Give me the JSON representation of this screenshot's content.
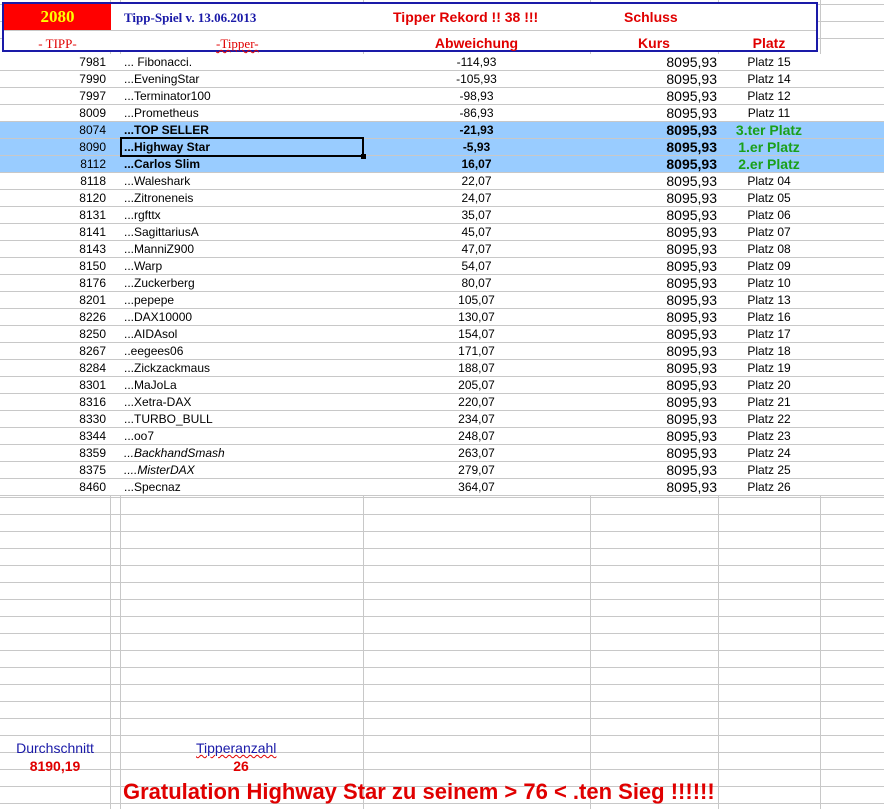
{
  "header": {
    "count": "2080",
    "title": "Tipp-Spiel v. 13.06.2013",
    "record": "Tipper Rekord !!  38  !!!",
    "schluss": "Schluss",
    "col_tipp": "- TIPP-",
    "col_tipper": "-Tipper-",
    "col_abw": "Abweichung",
    "col_kurs": "Kurs",
    "col_platz": "Platz"
  },
  "colors": {
    "accent_red": "#ff0000",
    "highlight": "#99ccff",
    "green": "#1aa01a",
    "blue": "#1a1aa8"
  },
  "rows": [
    {
      "tipp": "7981",
      "name": "... Fibonacci.",
      "abw": "-114,93",
      "kurs": "8095,93",
      "platz": "Platz 15"
    },
    {
      "tipp": "7990",
      "name": "...EveningStar",
      "abw": "-105,93",
      "kurs": "8095,93",
      "platz": "Platz 14"
    },
    {
      "tipp": "7997",
      "name": "...Terminator100",
      "abw": "-98,93",
      "kurs": "8095,93",
      "platz": "Platz 12"
    },
    {
      "tipp": "8009",
      "name": "...Prometheus",
      "abw": "-86,93",
      "kurs": "8095,93",
      "platz": "Platz 11"
    },
    {
      "tipp": "8074",
      "name": "...TOP  SELLER",
      "abw": "-21,93",
      "kurs": "8095,93",
      "platz": "3.ter Platz",
      "hl": true
    },
    {
      "tipp": "8090",
      "name": "...Highway  Star",
      "abw": "-5,93",
      "kurs": "8095,93",
      "platz": "1.er Platz",
      "hl": true
    },
    {
      "tipp": "8112",
      "name": "...Carlos Slim",
      "abw": "16,07",
      "kurs": "8095,93",
      "platz": "2.er Platz",
      "hl": true
    },
    {
      "tipp": "8118",
      "name": "...Waleshark",
      "abw": "22,07",
      "kurs": "8095,93",
      "platz": "Platz 04"
    },
    {
      "tipp": "8120",
      "name": "...Zitroneneis",
      "abw": "24,07",
      "kurs": "8095,93",
      "platz": "Platz 05"
    },
    {
      "tipp": "8131",
      "name": "...rgfttx",
      "abw": "35,07",
      "kurs": "8095,93",
      "platz": "Platz 06"
    },
    {
      "tipp": "8141",
      "name": "...SagittariusA",
      "abw": "45,07",
      "kurs": "8095,93",
      "platz": "Platz 07"
    },
    {
      "tipp": "8143",
      "name": "...ManniZ900",
      "abw": "47,07",
      "kurs": "8095,93",
      "platz": "Platz 08"
    },
    {
      "tipp": "8150",
      "name": "...Warp",
      "abw": "54,07",
      "kurs": "8095,93",
      "platz": "Platz 09"
    },
    {
      "tipp": "8176",
      "name": "...Zuckerberg",
      "abw": "80,07",
      "kurs": "8095,93",
      "platz": "Platz 10"
    },
    {
      "tipp": "8201",
      "name": "...pepepe",
      "abw": "105,07",
      "kurs": "8095,93",
      "platz": "Platz 13"
    },
    {
      "tipp": "8226",
      "name": "...DAX10000",
      "abw": "130,07",
      "kurs": "8095,93",
      "platz": "Platz 16"
    },
    {
      "tipp": "8250",
      "name": "...AIDAsol",
      "abw": "154,07",
      "kurs": "8095,93",
      "platz": "Platz 17"
    },
    {
      "tipp": "8267",
      "name": "..eegees06",
      "abw": "171,07",
      "kurs": "8095,93",
      "platz": "Platz 18"
    },
    {
      "tipp": "8284",
      "name": "...Zickzackmaus",
      "abw": "188,07",
      "kurs": "8095,93",
      "platz": "Platz 19"
    },
    {
      "tipp": "8301",
      "name": "...MaJoLa",
      "abw": "205,07",
      "kurs": "8095,93",
      "platz": "Platz 20"
    },
    {
      "tipp": "8316",
      "name": "...Xetra-DAX",
      "abw": "220,07",
      "kurs": "8095,93",
      "platz": "Platz 21"
    },
    {
      "tipp": "8330",
      "name": "...TURBO_BULL",
      "abw": "234,07",
      "kurs": "8095,93",
      "platz": "Platz 22"
    },
    {
      "tipp": "8344",
      "name": "...oo7",
      "abw": "248,07",
      "kurs": "8095,93",
      "platz": "Platz 23"
    },
    {
      "tipp": "8359",
      "name": "...BackhandSmash",
      "abw": "263,07",
      "kurs": "8095,93",
      "platz": "Platz 24",
      "italic": true
    },
    {
      "tipp": "8375",
      "name": "....MisterDAX",
      "abw": "279,07",
      "kurs": "8095,93",
      "platz": "Platz 25",
      "italic": true
    },
    {
      "tipp": "8460",
      "name": "...Specnaz",
      "abw": "364,07",
      "kurs": "8095,93",
      "platz": "Platz 26"
    }
  ],
  "footer": {
    "avg_label": "Durchschnitt",
    "avg_value": "8190,19",
    "count_label": "Tipperanzahl",
    "count_value": "26",
    "congrats": "Gratulation Highway Star  zu seinem > 76 < .ten Sieg !!!!!!"
  }
}
